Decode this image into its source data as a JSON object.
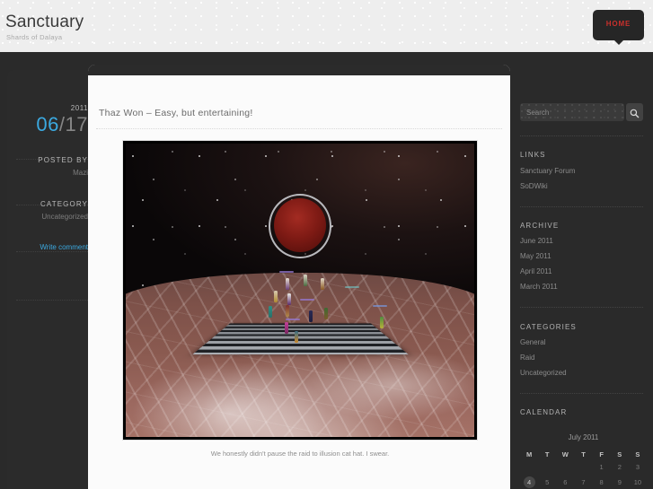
{
  "site": {
    "title": "Sanctuary",
    "tagline": "Shards of Dalaya"
  },
  "nav": {
    "home_label": "HOME"
  },
  "post_meta": {
    "year": "2011",
    "month": "06",
    "day": "17",
    "posted_by_label": "POSTED BY",
    "author": "Mazi",
    "category_label": "CATEGORY",
    "category": "Uncategorized",
    "comment_link": "Write comment"
  },
  "post": {
    "title": "Thaz Won – Easy, but entertaining!",
    "caption": "We honestly didn't pause the raid to illusion cat hat. I swear."
  },
  "search": {
    "placeholder": "Search",
    "value": "",
    "button_icon": "search-icon"
  },
  "sidebar": {
    "links": {
      "heading": "LINKS",
      "items": [
        {
          "label": "Sanctuary Forum"
        },
        {
          "label": "SoDWiki"
        }
      ]
    },
    "archive": {
      "heading": "ARCHIVE",
      "items": [
        {
          "label": "June 2011"
        },
        {
          "label": "May 2011"
        },
        {
          "label": "April 2011"
        },
        {
          "label": "March 2011"
        }
      ]
    },
    "categories": {
      "heading": "CATEGORIES",
      "items": [
        {
          "label": "General"
        },
        {
          "label": "Raid"
        },
        {
          "label": "Uncategorized"
        }
      ]
    },
    "calendar": {
      "heading": "CALENDAR",
      "caption": "July 2011",
      "weekdays": [
        "M",
        "T",
        "W",
        "T",
        "F",
        "S",
        "S"
      ],
      "weeks": [
        [
          "",
          "",
          "",
          "",
          "1",
          "2",
          "3"
        ],
        [
          "4",
          "5",
          "6",
          "7",
          "8",
          "9",
          "10"
        ]
      ],
      "today": "4"
    }
  },
  "colors": {
    "accent_blue": "#3ba9e0",
    "accent_red": "#c9302c",
    "dark_bg": "#2a2a2a",
    "card_bg": "#fbfbfb"
  }
}
